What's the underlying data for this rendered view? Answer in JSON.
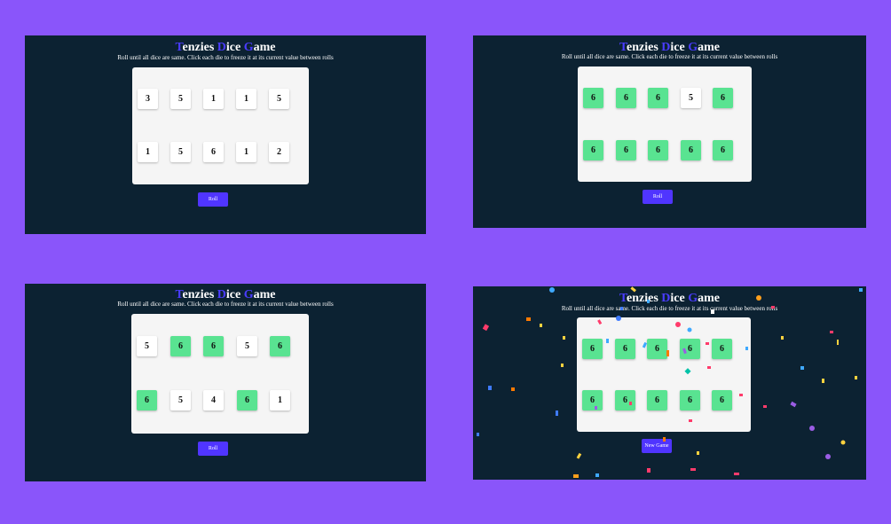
{
  "game": {
    "title_parts": [
      {
        "initial": "T",
        "rest": "enzies "
      },
      {
        "initial": "D",
        "rest": "ice "
      },
      {
        "initial": "G",
        "rest": "ame"
      }
    ],
    "instructions": "Roll until all dice are same. Click each die to freeze it at its current value between rolls",
    "roll_label": "Roll",
    "new_game_label": "New Game"
  },
  "colors": {
    "page_background": "#8a55fa",
    "panel_background": "#0c2232",
    "board_background": "#f5f5f5",
    "held_die": "#59e391",
    "button": "#5035ff",
    "title_initial": "#4a3cff"
  },
  "screens": [
    {
      "button": "roll_label",
      "dice": [
        {
          "value": "3",
          "held": false
        },
        {
          "value": "5",
          "held": false
        },
        {
          "value": "1",
          "held": false
        },
        {
          "value": "1",
          "held": false
        },
        {
          "value": "5",
          "held": false
        },
        {
          "value": "1",
          "held": false
        },
        {
          "value": "5",
          "held": false
        },
        {
          "value": "6",
          "held": false
        },
        {
          "value": "1",
          "held": false
        },
        {
          "value": "2",
          "held": false
        }
      ]
    },
    {
      "button": "roll_label",
      "dice": [
        {
          "value": "6",
          "held": true
        },
        {
          "value": "6",
          "held": true
        },
        {
          "value": "6",
          "held": true
        },
        {
          "value": "5",
          "held": false
        },
        {
          "value": "6",
          "held": true
        },
        {
          "value": "6",
          "held": true
        },
        {
          "value": "6",
          "held": true
        },
        {
          "value": "6",
          "held": true
        },
        {
          "value": "6",
          "held": true
        },
        {
          "value": "6",
          "held": true
        }
      ]
    },
    {
      "button": "roll_label",
      "dice": [
        {
          "value": "5",
          "held": false
        },
        {
          "value": "6",
          "held": true
        },
        {
          "value": "6",
          "held": true
        },
        {
          "value": "5",
          "held": false
        },
        {
          "value": "6",
          "held": true
        },
        {
          "value": "6",
          "held": true
        },
        {
          "value": "5",
          "held": false
        },
        {
          "value": "4",
          "held": false
        },
        {
          "value": "6",
          "held": true
        },
        {
          "value": "1",
          "held": false
        }
      ]
    },
    {
      "button": "new_game_label",
      "confetti": true,
      "dice": [
        {
          "value": "6",
          "held": true
        },
        {
          "value": "6",
          "held": true
        },
        {
          "value": "6",
          "held": true
        },
        {
          "value": "6",
          "held": true
        },
        {
          "value": "6",
          "held": true
        },
        {
          "value": "6",
          "held": true
        },
        {
          "value": "6",
          "held": true
        },
        {
          "value": "6",
          "held": true
        },
        {
          "value": "6",
          "held": true
        },
        {
          "value": "6",
          "held": true
        }
      ]
    }
  ]
}
